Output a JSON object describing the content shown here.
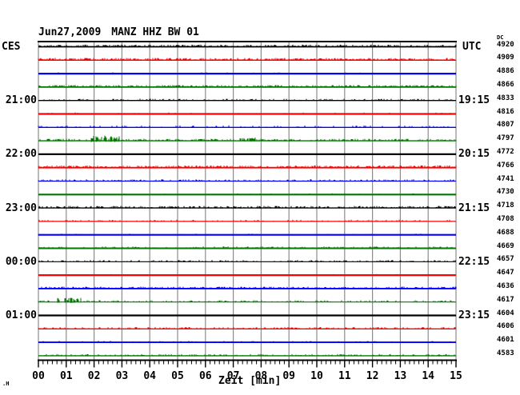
{
  "title": {
    "date": "Jun27,2009",
    "station": "MANZ HHZ BW 01"
  },
  "left_header": "CES",
  "right_header": "UTC",
  "dc_header": "DC",
  "corner_mark": ".H",
  "xaxis": {
    "label": "Zeit [min]",
    "tick_labels": [
      "00",
      "01",
      "02",
      "03",
      "04",
      "05",
      "06",
      "07",
      "08",
      "09",
      "10",
      "11",
      "12",
      "13",
      "14",
      "15"
    ],
    "minutes_total": 15,
    "minor_divisions_per_minute": 6
  },
  "colors": {
    "black": "#000000",
    "red": "#ff0000",
    "blue": "#0000ff",
    "green": "#007800",
    "grid": "#8c8c8c",
    "background": "#ffffff"
  },
  "chart_data": {
    "type": "line",
    "subtype": "helicorder",
    "station": "MANZ HHZ BW 01",
    "date": "Jun27,2009",
    "timezone_left": "CES",
    "timezone_right": "UTC",
    "minutes_per_line": 15,
    "x_range": [
      0,
      15
    ],
    "color_cycle": [
      "black",
      "red",
      "blue",
      "green"
    ],
    "traces": [
      {
        "cest": "",
        "utc": "",
        "color": "black",
        "dc": 4920,
        "noise": {
          "width": 1.7,
          "density": 0.38,
          "amp": 1.8
        },
        "bursts": []
      },
      {
        "cest": "",
        "utc": "",
        "color": "red",
        "dc": 4909,
        "noise": {
          "width": 1.5,
          "density": 0.55,
          "amp": 1.9
        },
        "bursts": []
      },
      {
        "cest": "",
        "utc": "",
        "color": "blue",
        "dc": 4886,
        "noise": {
          "width": 2.2,
          "density": 0.05,
          "amp": 1.1
        },
        "bursts": []
      },
      {
        "cest": "",
        "utc": "",
        "color": "green",
        "dc": 4866,
        "noise": {
          "width": 1.8,
          "density": 0.5,
          "amp": 1.7
        },
        "bursts": []
      },
      {
        "cest": "21:00",
        "utc": "19:15",
        "color": "black",
        "dc": 4833,
        "noise": {
          "width": 1.4,
          "density": 0.3,
          "amp": 1.5
        },
        "bursts": []
      },
      {
        "cest": "",
        "utc": "",
        "color": "red",
        "dc": 4816,
        "noise": {
          "width": 2.2,
          "density": 0.07,
          "amp": 1.3
        },
        "bursts": []
      },
      {
        "cest": "",
        "utc": "",
        "color": "blue",
        "dc": 4807,
        "noise": {
          "width": 1.4,
          "density": 0.18,
          "amp": 1.6
        },
        "bursts": []
      },
      {
        "cest": "",
        "utc": "",
        "color": "green",
        "dc": 4797,
        "noise": {
          "width": 1.4,
          "density": 0.45,
          "amp": 1.7
        },
        "bursts": [
          {
            "start": 1.85,
            "end": 2.95,
            "gain": 2.6
          },
          {
            "start": 7.2,
            "end": 7.8,
            "gain": 1.6
          }
        ]
      },
      {
        "cest": "22:00",
        "utc": "20:15",
        "color": "black",
        "dc": 4772,
        "noise": {
          "width": 2.3,
          "density": 0.01,
          "amp": 0.8
        },
        "bursts": []
      },
      {
        "cest": "",
        "utc": "",
        "color": "red",
        "dc": 4766,
        "noise": {
          "width": 1.9,
          "density": 0.5,
          "amp": 1.9
        },
        "bursts": []
      },
      {
        "cest": "",
        "utc": "",
        "color": "blue",
        "dc": 4741,
        "noise": {
          "width": 1.3,
          "density": 0.3,
          "amp": 1.5
        },
        "bursts": []
      },
      {
        "cest": "",
        "utc": "",
        "color": "green",
        "dc": 4730,
        "noise": {
          "width": 2.2,
          "density": 0.04,
          "amp": 1.0
        },
        "bursts": []
      },
      {
        "cest": "23:00",
        "utc": "21:15",
        "color": "black",
        "dc": 4718,
        "noise": {
          "width": 1.4,
          "density": 0.42,
          "amp": 1.7
        },
        "bursts": []
      },
      {
        "cest": "",
        "utc": "",
        "color": "red",
        "dc": 4708,
        "noise": {
          "width": 1.2,
          "density": 0.2,
          "amp": 1.4
        },
        "bursts": []
      },
      {
        "cest": "",
        "utc": "",
        "color": "blue",
        "dc": 4688,
        "noise": {
          "width": 2.2,
          "density": 0.05,
          "amp": 1.0
        },
        "bursts": []
      },
      {
        "cest": "",
        "utc": "",
        "color": "green",
        "dc": 4669,
        "noise": {
          "width": 1.9,
          "density": 0.33,
          "amp": 1.5
        },
        "bursts": []
      },
      {
        "cest": "00:00",
        "utc": "22:15",
        "color": "black",
        "dc": 4657,
        "noise": {
          "width": 1.2,
          "density": 0.26,
          "amp": 1.4
        },
        "bursts": []
      },
      {
        "cest": "",
        "utc": "",
        "color": "red",
        "dc": 4647,
        "noise": {
          "width": 2.2,
          "density": 0.03,
          "amp": 0.9
        },
        "bursts": []
      },
      {
        "cest": "",
        "utc": "",
        "color": "blue",
        "dc": 4636,
        "noise": {
          "width": 1.9,
          "density": 0.42,
          "amp": 1.6
        },
        "bursts": []
      },
      {
        "cest": "",
        "utc": "",
        "color": "green",
        "dc": 4617,
        "noise": {
          "width": 1.2,
          "density": 0.3,
          "amp": 1.5
        },
        "bursts": [
          {
            "start": 0.45,
            "end": 1.55,
            "gain": 2.4
          }
        ]
      },
      {
        "cest": "01:00",
        "utc": "23:15",
        "color": "black",
        "dc": 4604,
        "noise": {
          "width": 2.2,
          "density": 0.02,
          "amp": 0.8
        },
        "bursts": []
      },
      {
        "cest": "",
        "utc": "",
        "color": "red",
        "dc": 4606,
        "noise": {
          "width": 1.4,
          "density": 0.32,
          "amp": 1.5
        },
        "bursts": []
      },
      {
        "cest": "",
        "utc": "",
        "color": "blue",
        "dc": 4601,
        "noise": {
          "width": 1.9,
          "density": 0.12,
          "amp": 1.2
        },
        "bursts": []
      },
      {
        "cest": "",
        "utc": "",
        "color": "green",
        "dc": 4583,
        "noise": {
          "width": 1.4,
          "density": 0.26,
          "amp": 1.4
        },
        "bursts": []
      }
    ]
  }
}
